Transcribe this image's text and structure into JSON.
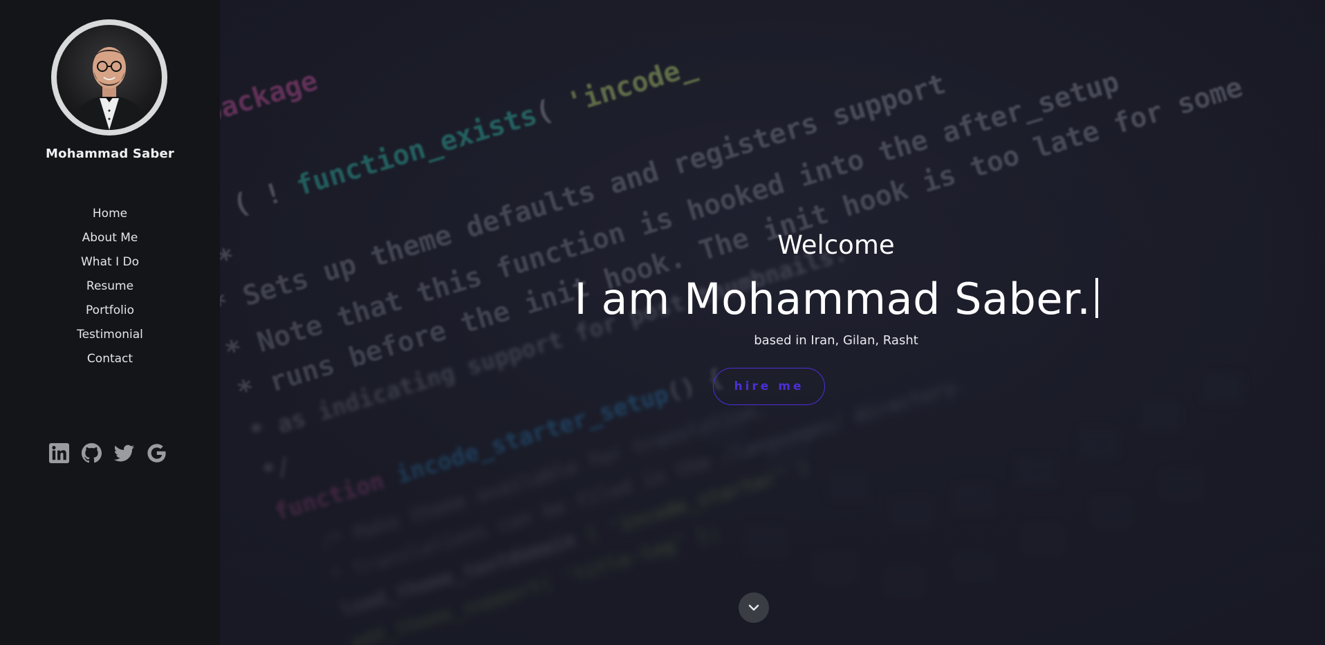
{
  "profile": {
    "name": "Mohammad Saber",
    "avatar_icon": "portrait-photo"
  },
  "nav": {
    "items": [
      {
        "label": "Home"
      },
      {
        "label": "About Me"
      },
      {
        "label": "What I Do"
      },
      {
        "label": "Resume"
      },
      {
        "label": "Portfolio"
      },
      {
        "label": "Testimonial"
      },
      {
        "label": "Contact"
      }
    ]
  },
  "social": {
    "icons": [
      "linkedin-icon",
      "github-icon",
      "twitter-icon",
      "google-icon"
    ],
    "color": "#9b9ca0"
  },
  "hero": {
    "welcome": "Welcome",
    "headline": "I am Mohammad Saber.",
    "location": "based in Iran, Gilan, Rasht",
    "hire_label": "hire me",
    "accent_color": "#4b2fd6",
    "scroll_icon": "chevron-down-icon"
  }
}
